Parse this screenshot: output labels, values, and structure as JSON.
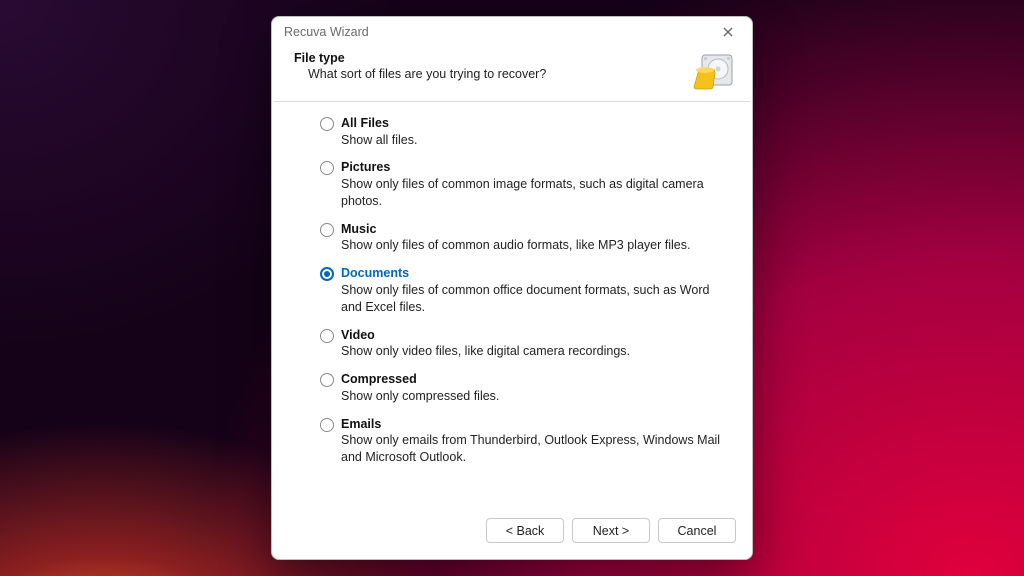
{
  "window": {
    "title": "Recuva Wizard"
  },
  "header": {
    "title": "File type",
    "subtitle": "What sort of files are you trying to recover?"
  },
  "options": [
    {
      "id": "all",
      "label": "All Files",
      "desc": "Show all files.",
      "selected": false
    },
    {
      "id": "pictures",
      "label": "Pictures",
      "desc": "Show only files of common image formats, such as digital camera photos.",
      "selected": false
    },
    {
      "id": "music",
      "label": "Music",
      "desc": "Show only files of common audio formats, like MP3 player files.",
      "selected": false
    },
    {
      "id": "documents",
      "label": "Documents",
      "desc": "Show only files of common office document formats, such as Word and Excel files.",
      "selected": true
    },
    {
      "id": "video",
      "label": "Video",
      "desc": "Show only video files, like digital camera recordings.",
      "selected": false
    },
    {
      "id": "compressed",
      "label": "Compressed",
      "desc": "Show only compressed files.",
      "selected": false
    },
    {
      "id": "emails",
      "label": "Emails",
      "desc": "Show only emails from Thunderbird, Outlook Express, Windows Mail and Microsoft Outlook.",
      "selected": false
    }
  ],
  "buttons": {
    "back": "< Back",
    "next": "Next >",
    "cancel": "Cancel"
  }
}
